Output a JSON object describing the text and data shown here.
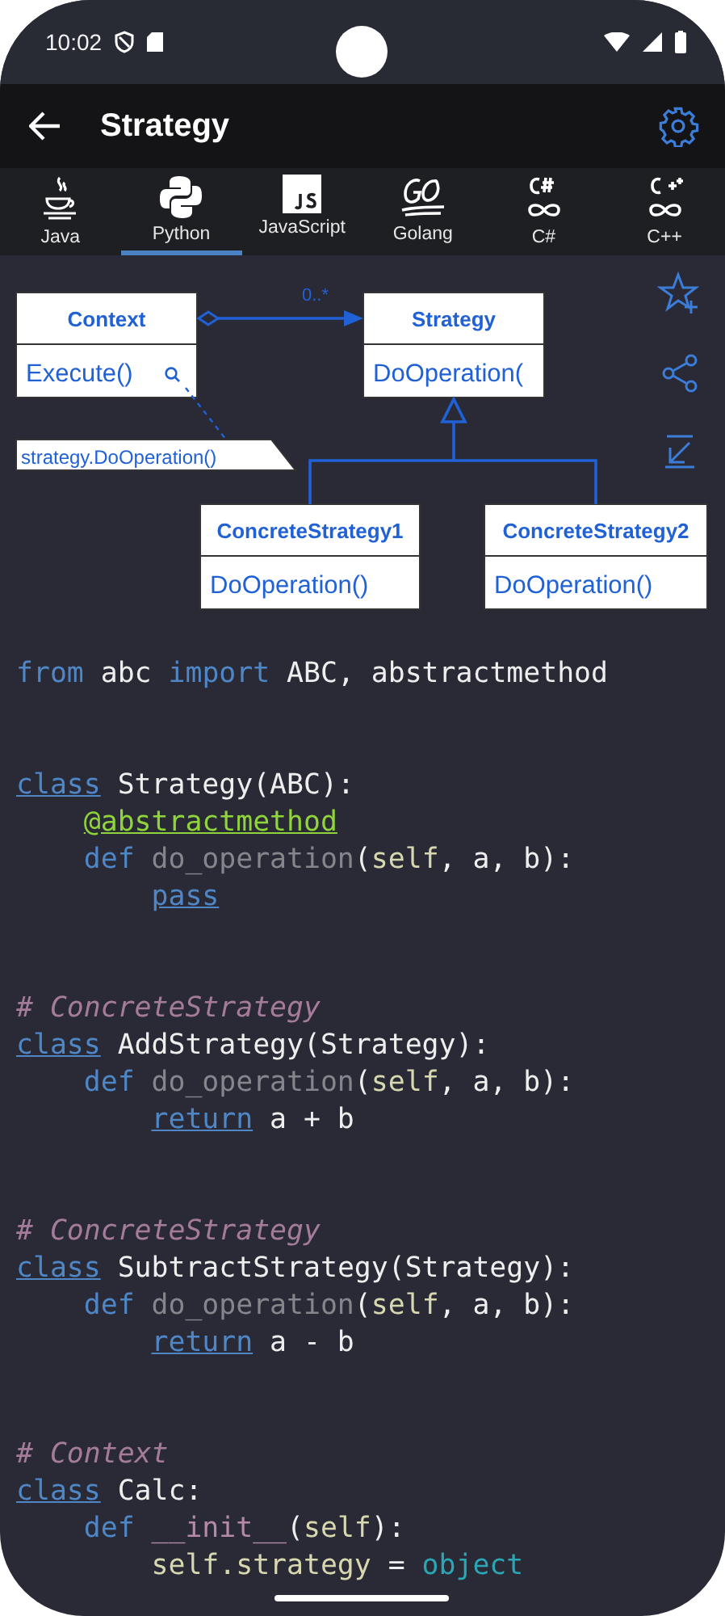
{
  "status_bar": {
    "time": "10:02"
  },
  "app_bar": {
    "title": "Strategy"
  },
  "tabs": [
    {
      "label": "Java",
      "selected": false
    },
    {
      "label": "Python",
      "selected": true
    },
    {
      "label": "JavaScript",
      "selected": false
    },
    {
      "label": "Golang",
      "selected": false
    },
    {
      "label": "C#",
      "selected": false
    },
    {
      "label": "C++",
      "selected": false
    }
  ],
  "diagram": {
    "classes": [
      {
        "name": "Context",
        "method": "Execute()"
      },
      {
        "name": "Strategy",
        "method": "DoOperation("
      },
      {
        "name": "ConcreteStrategy1",
        "method": "DoOperation()"
      },
      {
        "name": "ConcreteStrategy2",
        "method": "DoOperation()"
      }
    ],
    "multiplicity": "0..*",
    "note": "strategy.DoOperation()"
  },
  "code_blocks": [
    {
      "lines": [
        {
          "tokens": [
            {
              "text": "from",
              "kind": "keyword"
            },
            {
              "text": " abc ",
              "kind": "plain"
            },
            {
              "text": "import",
              "kind": "keyword"
            },
            {
              "text": " ABC, abstractmethod",
              "kind": "plain"
            }
          ]
        }
      ]
    },
    {
      "lines": [
        {
          "tokens": [
            {
              "text": "class",
              "kind": "link"
            },
            {
              "text": " Strategy(ABC):",
              "kind": "plain"
            }
          ],
          "children": [
            {
              "tokens": [
                {
                  "text": "@abstractmethod",
                  "kind": "decorator"
                }
              ]
            },
            {
              "tokens": [
                {
                  "text": "def",
                  "kind": "keyword"
                },
                {
                  "text": " do_operation",
                  "kind": "function"
                },
                {
                  "text": "(",
                  "kind": "plain"
                },
                {
                  "text": "self",
                  "kind": "self"
                },
                {
                  "text": ", a, b):",
                  "kind": "plain"
                }
              ],
              "children": [
                {
                  "tokens": [
                    {
                      "text": "pass",
                      "kind": "link"
                    }
                  ]
                }
              ]
            }
          ]
        }
      ]
    },
    {
      "lines": [
        {
          "tokens": [
            {
              "text": "# ConcreteStrategy",
              "kind": "comment"
            }
          ]
        },
        {
          "tokens": [
            {
              "text": "class",
              "kind": "link"
            },
            {
              "text": " AddStrategy(Strategy):",
              "kind": "plain"
            }
          ],
          "children": [
            {
              "tokens": [
                {
                  "text": "def",
                  "kind": "keyword"
                },
                {
                  "text": " do_operation",
                  "kind": "function"
                },
                {
                  "text": "(",
                  "kind": "plain"
                },
                {
                  "text": "self",
                  "kind": "self"
                },
                {
                  "text": ", a, b):",
                  "kind": "plain"
                }
              ],
              "children": [
                {
                  "tokens": [
                    {
                      "text": "return",
                      "kind": "link"
                    },
                    {
                      "text": " a + b",
                      "kind": "plain"
                    }
                  ]
                }
              ]
            }
          ]
        }
      ]
    },
    {
      "lines": [
        {
          "tokens": [
            {
              "text": "# ConcreteStrategy",
              "kind": "comment"
            }
          ]
        },
        {
          "tokens": [
            {
              "text": "class",
              "kind": "link"
            },
            {
              "text": " SubtractStrategy(Strategy):",
              "kind": "plain"
            }
          ],
          "children": [
            {
              "tokens": [
                {
                  "text": "def",
                  "kind": "keyword"
                },
                {
                  "text": " do_operation",
                  "kind": "function"
                },
                {
                  "text": "(",
                  "kind": "plain"
                },
                {
                  "text": "self",
                  "kind": "self"
                },
                {
                  "text": ", a, b):",
                  "kind": "plain"
                }
              ],
              "children": [
                {
                  "tokens": [
                    {
                      "text": "return",
                      "kind": "link"
                    },
                    {
                      "text": " a - b",
                      "kind": "plain"
                    }
                  ]
                }
              ]
            }
          ]
        }
      ]
    },
    {
      "lines": [
        {
          "tokens": [
            {
              "text": "# Context",
              "kind": "comment"
            }
          ]
        },
        {
          "tokens": [
            {
              "text": "class",
              "kind": "link"
            },
            {
              "text": " Calc:",
              "kind": "plain"
            }
          ],
          "children": [
            {
              "tokens": [
                {
                  "text": "def",
                  "kind": "keyword"
                },
                {
                  "text": " __init__",
                  "kind": "special"
                },
                {
                  "text": "(",
                  "kind": "plain"
                },
                {
                  "text": "self",
                  "kind": "self"
                },
                {
                  "text": "):",
                  "kind": "plain"
                }
              ],
              "children": [
                {
                  "tokens": [
                    {
                      "text": "self.strategy",
                      "kind": "self"
                    },
                    {
                      "text": " = ",
                      "kind": "plain"
                    },
                    {
                      "text": "object",
                      "kind": "builtin"
                    }
                  ]
                }
              ]
            }
          ]
        }
      ]
    }
  ]
}
